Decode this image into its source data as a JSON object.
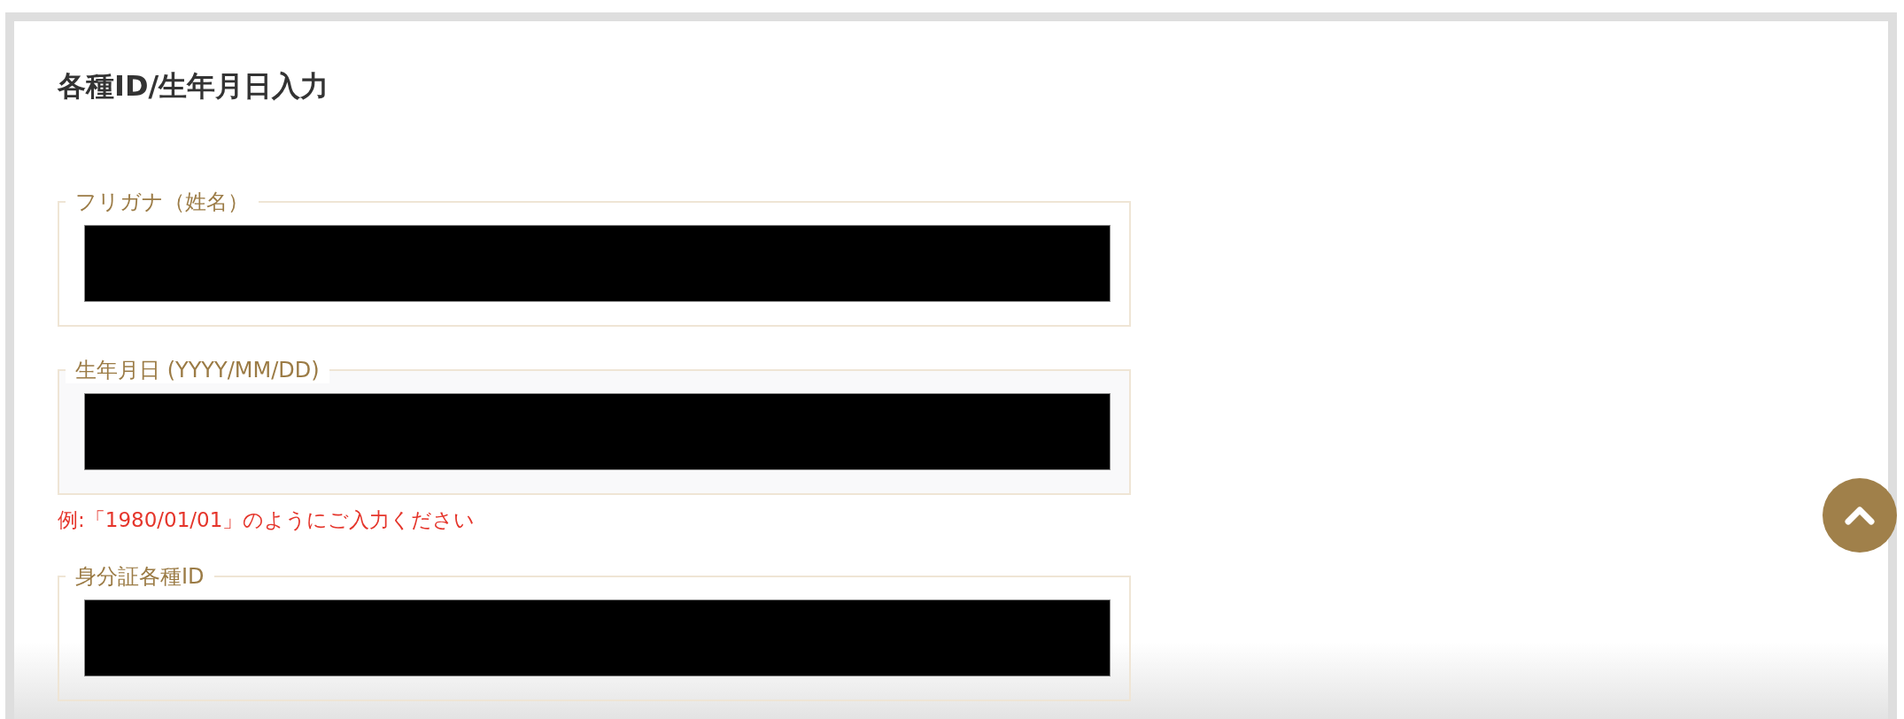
{
  "page": {
    "title": "各種ID/生年月日入力"
  },
  "fields": [
    {
      "label": "フリガナ（姓名）",
      "highlighted": false,
      "redacted": true
    },
    {
      "label": "生年月日 (YYYY/MM/DD)",
      "highlighted": true,
      "redacted": true,
      "hint": "例:「1980/01/01」のようにご入力ください"
    },
    {
      "label": "身分証各種ID",
      "highlighted": false,
      "redacted": true
    }
  ]
}
